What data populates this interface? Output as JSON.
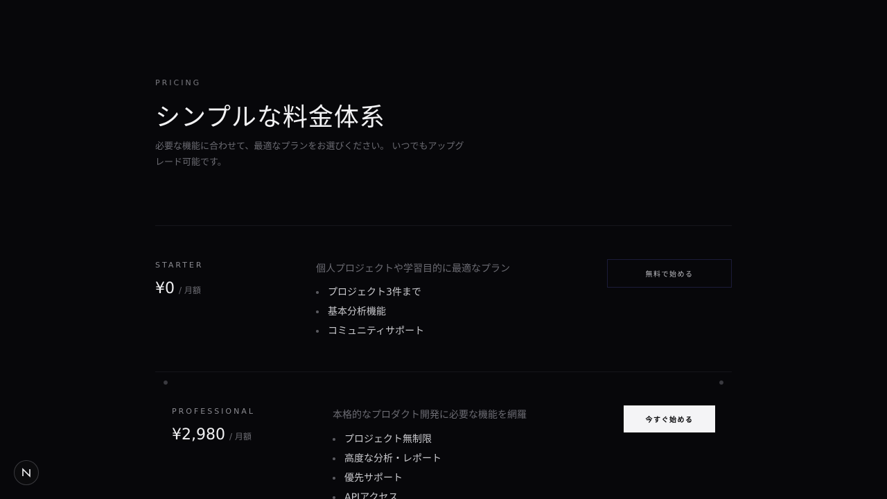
{
  "header": {
    "eyebrow": "PRICING",
    "title": "シンプルな料金体系",
    "subtitle": "必要な機能に合わせて、最適なプランをお選びください。 いつでもアップグレード可能です。"
  },
  "plans": [
    {
      "name": "STARTER",
      "price": "¥0",
      "unit": "/ 月額",
      "description": "個人プロジェクトや学習目的に最適なプラン",
      "features": [
        "プロジェクト3件まで",
        "基本分析機能",
        "コミュニティサポート"
      ],
      "cta": "無料で始める"
    },
    {
      "name": "PROFESSIONAL",
      "price": "¥2,980",
      "unit": "/ 月額",
      "description": "本格的なプロダクト開発に必要な機能を網羅",
      "features": [
        "プロジェクト無制限",
        "高度な分析・レポート",
        "優先サポート",
        "APIアクセス"
      ],
      "cta": "今すぐ始める"
    }
  ],
  "badge": {
    "label": "N",
    "icon": "nextjs-logo-icon"
  },
  "colors": {
    "background": "#07070a",
    "text": "#f2f2f4",
    "muted": "#6b6b72",
    "button_solid": "#f4f4f6"
  }
}
